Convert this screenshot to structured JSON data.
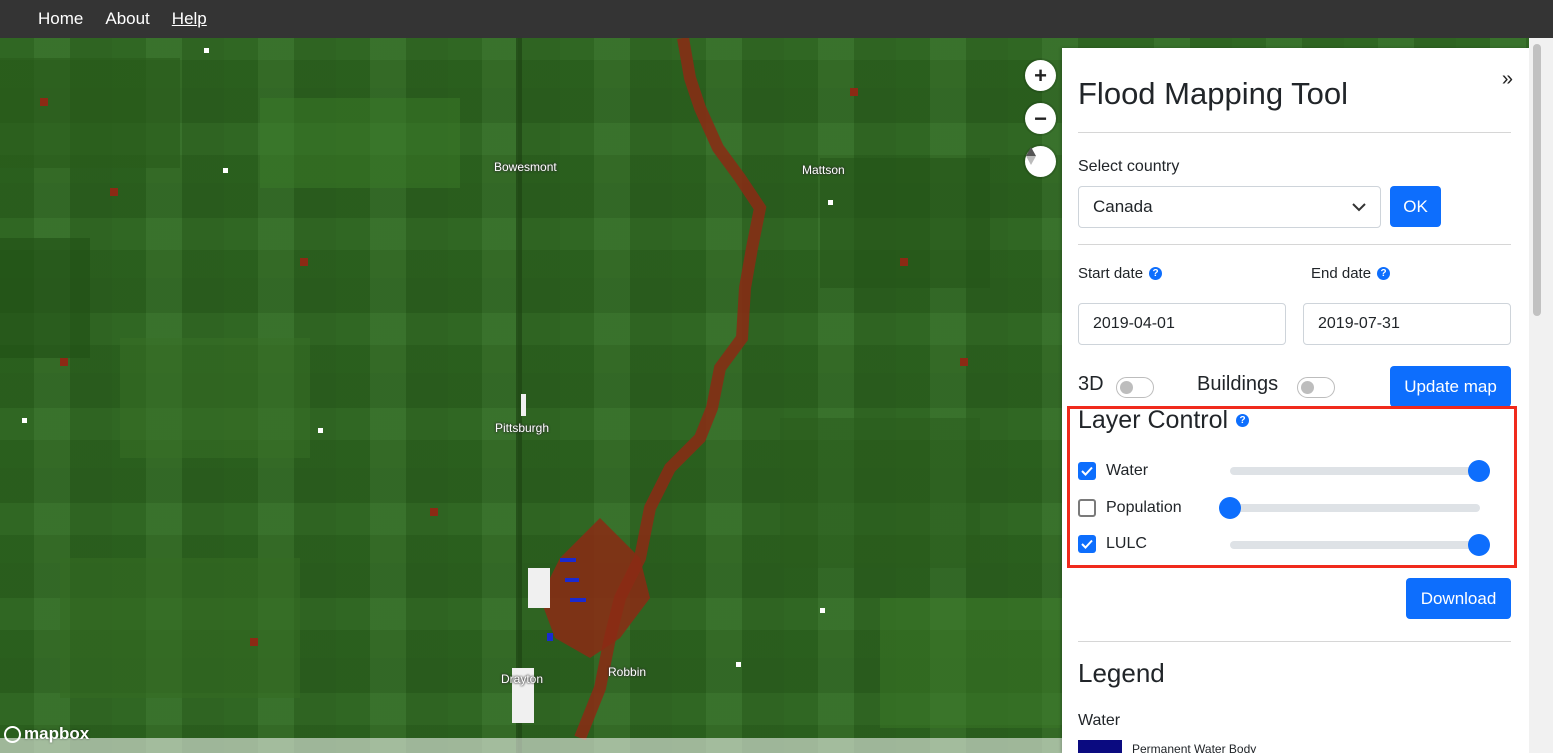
{
  "nav": {
    "home": "Home",
    "about": "About",
    "help": "Help"
  },
  "map": {
    "towns": [
      "Bowesmont",
      "Mattson",
      "Pittsburgh",
      "Drayton",
      "Robbin"
    ],
    "attribution": "mapbox",
    "controls": {
      "zoom_in": "+",
      "zoom_out": "−"
    }
  },
  "panel": {
    "collapse": "»",
    "title": "Flood Mapping Tool",
    "country_label": "Select country",
    "country_value": "Canada",
    "ok_label": "OK",
    "start_date_label": "Start date",
    "end_date_label": "End date",
    "start_date": "2019-04-01",
    "end_date": "2019-07-31",
    "toggle_3d": "3D",
    "toggle_buildings": "Buildings",
    "update_map": "Update map",
    "layer_control_title": "Layer Control",
    "layers": [
      {
        "label": "Water",
        "checked": true,
        "opacity": 1.0
      },
      {
        "label": "Population",
        "checked": false,
        "opacity": 0.0
      },
      {
        "label": "LULC",
        "checked": true,
        "opacity": 1.0
      }
    ],
    "download": "Download",
    "legend_title": "Legend",
    "legend_sub": "Water",
    "legend_items": [
      "Permanent Water Body"
    ]
  },
  "colors": {
    "accent": "#0d6efd",
    "highlight": "#f02a1c",
    "nav_bg": "#343434",
    "water_swatch": "#0a0a80"
  }
}
